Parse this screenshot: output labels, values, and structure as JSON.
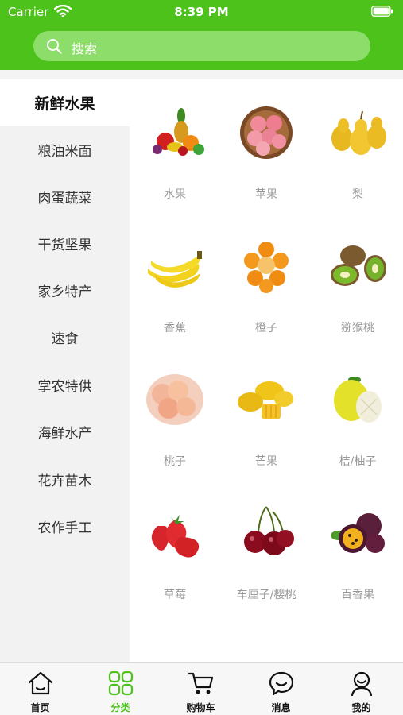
{
  "status_bar": {
    "carrier": "Carrier",
    "time": "8:39 PM"
  },
  "search": {
    "placeholder": "搜索"
  },
  "sidebar": {
    "items": [
      {
        "label": "新鲜水果",
        "active": true
      },
      {
        "label": "粮油米面"
      },
      {
        "label": "肉蛋蔬菜"
      },
      {
        "label": "干货坚果"
      },
      {
        "label": "家乡特产"
      },
      {
        "label": "速食"
      },
      {
        "label": "掌农特供"
      },
      {
        "label": "海鲜水产"
      },
      {
        "label": "花卉苗木"
      },
      {
        "label": "农作手工"
      }
    ]
  },
  "products": [
    {
      "label": "水果",
      "icon": "fruit-basket-icon"
    },
    {
      "label": "苹果",
      "icon": "apple-icon"
    },
    {
      "label": "梨",
      "icon": "pear-icon"
    },
    {
      "label": "香蕉",
      "icon": "banana-icon"
    },
    {
      "label": "橙子",
      "icon": "orange-icon"
    },
    {
      "label": "猕猴桃",
      "icon": "kiwi-icon"
    },
    {
      "label": "桃子",
      "icon": "peach-icon"
    },
    {
      "label": "芒果",
      "icon": "mango-icon"
    },
    {
      "label": "桔/柚子",
      "icon": "pomelo-icon"
    },
    {
      "label": "草莓",
      "icon": "strawberry-icon"
    },
    {
      "label": "车厘子/樱桃",
      "icon": "cherry-icon"
    },
    {
      "label": "百香果",
      "icon": "passion-fruit-icon"
    },
    {
      "label": "",
      "icon": "durian-icon"
    }
  ],
  "tabbar": {
    "tabs": [
      {
        "label": "首页",
        "icon": "home-icon"
      },
      {
        "label": "分类",
        "icon": "category-grid-icon",
        "active": true
      },
      {
        "label": "购物车",
        "icon": "cart-icon"
      },
      {
        "label": "消息",
        "icon": "message-icon"
      },
      {
        "label": "我的",
        "icon": "profile-icon"
      }
    ]
  },
  "colors": {
    "brand_green": "#4cc21a",
    "search_bg": "#8ddd6a",
    "sidebar_bg": "#f2f2f2",
    "label_grey": "#999999"
  }
}
